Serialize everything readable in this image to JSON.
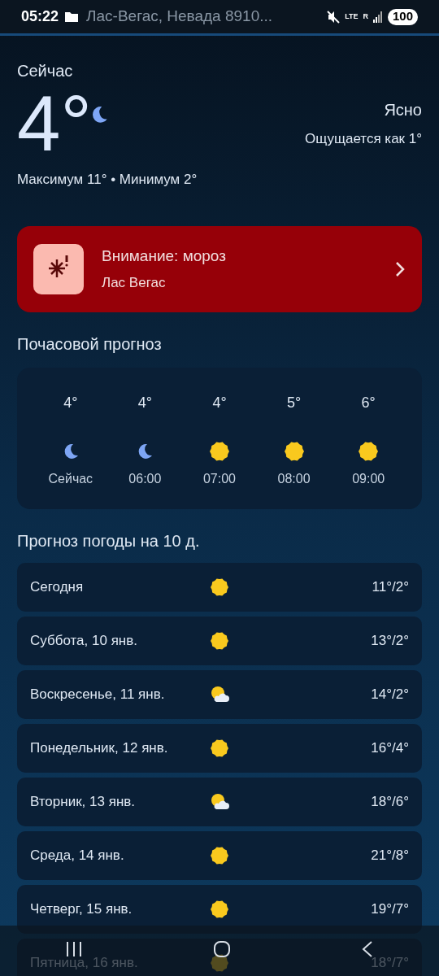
{
  "status_bar": {
    "time": "05:22",
    "network": "LTE",
    "roaming": "R",
    "battery": "100"
  },
  "search": {
    "value": "Лас-Вегас, Невада 8910..."
  },
  "current": {
    "label": "Сейчас",
    "temp": "4°",
    "kind": "moon",
    "condition": "Ясно",
    "feels_like": "Ощущается как 1°",
    "high_low": "Максимум 11° • Минимум 2°"
  },
  "alert": {
    "title": "Внимание: мороз",
    "location": "Лас Вегас"
  },
  "hourly": {
    "title": "Почасовой прогноз",
    "items": [
      {
        "temp": "4°",
        "kind": "moon",
        "time": "Сейчас"
      },
      {
        "temp": "4°",
        "kind": "moon",
        "time": "06:00"
      },
      {
        "temp": "4°",
        "kind": "sun",
        "time": "07:00"
      },
      {
        "temp": "5°",
        "kind": "sun",
        "time": "08:00"
      },
      {
        "temp": "6°",
        "kind": "sun",
        "time": "09:00"
      }
    ]
  },
  "daily": {
    "title": "Прогноз погоды на 10 д.",
    "items": [
      {
        "day": "Сегодня",
        "kind": "sun",
        "temps": "11°/2°"
      },
      {
        "day": "Суббота, 10 янв.",
        "kind": "sun",
        "temps": "13°/2°"
      },
      {
        "day": "Воскресенье, 11 янв.",
        "kind": "sun_cloud",
        "temps": "14°/2°"
      },
      {
        "day": "Понедельник, 12 янв.",
        "kind": "sun",
        "temps": "16°/4°"
      },
      {
        "day": "Вторник, 13 янв.",
        "kind": "sun_cloud",
        "temps": "18°/6°"
      },
      {
        "day": "Среда, 14 янв.",
        "kind": "sun",
        "temps": "21°/8°"
      },
      {
        "day": "Четверг, 15 янв.",
        "kind": "sun",
        "temps": "19°/7°"
      },
      {
        "day": "Пятница, 16 янв.",
        "kind": "sun",
        "temps": "18°/7°"
      }
    ]
  }
}
